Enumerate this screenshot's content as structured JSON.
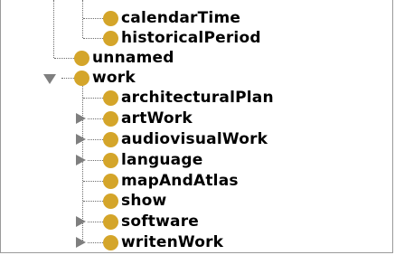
{
  "tree": {
    "nodes": [
      {
        "label": "calendarTime",
        "expander": "none"
      },
      {
        "label": "historicalPeriod",
        "expander": "none"
      },
      {
        "label": "unnamed",
        "expander": "none"
      },
      {
        "label": "work",
        "expander": "expanded"
      },
      {
        "label": "architecturalPlan",
        "expander": "none"
      },
      {
        "label": "artWork",
        "expander": "collapsed"
      },
      {
        "label": "audiovisualWork",
        "expander": "collapsed"
      },
      {
        "label": "language",
        "expander": "collapsed"
      },
      {
        "label": "mapAndAtlas",
        "expander": "none"
      },
      {
        "label": "show",
        "expander": "none"
      },
      {
        "label": "software",
        "expander": "collapsed"
      },
      {
        "label": "writenWork",
        "expander": "collapsed"
      }
    ],
    "node_color": "#d4a52a",
    "connector_color": "#6c6c6c",
    "expander_color": "#7f7f7f"
  }
}
